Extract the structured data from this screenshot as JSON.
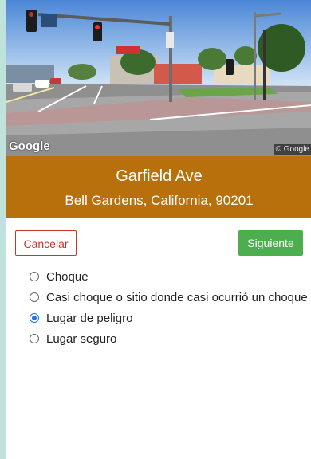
{
  "street_view": {
    "logo": "Google",
    "copyright": "© Google"
  },
  "address": {
    "street": "Garfield Ave",
    "city_line": "Bell Gardens, California, 90201"
  },
  "actions": {
    "cancel_label": "Cancelar",
    "next_label": "Siguiente"
  },
  "options": [
    {
      "label": "Choque",
      "selected": false
    },
    {
      "label": "Casi choque o sitio donde casi ocurrió un choque",
      "selected": false
    },
    {
      "label": "Lugar de peligro",
      "selected": true
    },
    {
      "label": "Lugar seguro",
      "selected": false
    }
  ],
  "colors": {
    "address_band": "#b8700d",
    "next_button": "#4cae4c",
    "cancel_border": "#c0392b",
    "radio_selected": "#1a73e8"
  }
}
